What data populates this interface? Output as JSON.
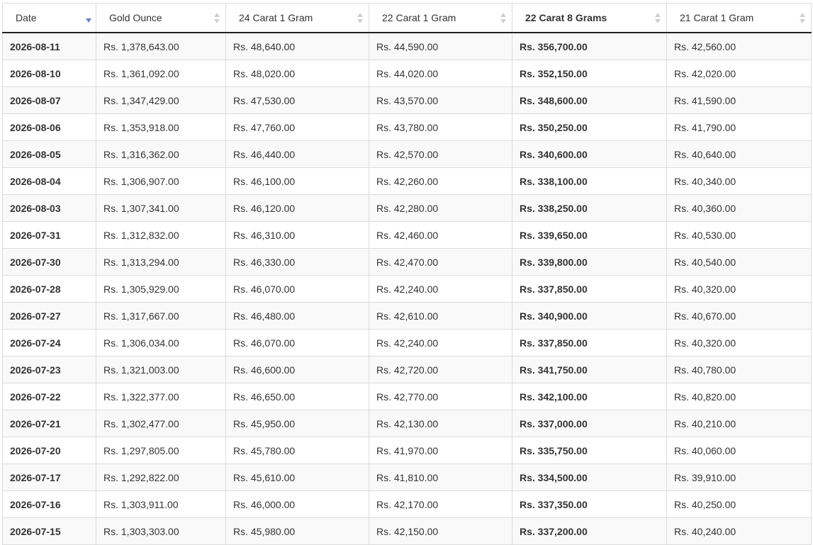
{
  "columns": [
    {
      "label": "Date",
      "sort": "descending"
    },
    {
      "label": "Gold Ounce",
      "sort": "none"
    },
    {
      "label": "24 Carat 1 Gram",
      "sort": "none"
    },
    {
      "label": "22 Carat 1 Gram",
      "sort": "none"
    },
    {
      "label": "22 Carat 8 Grams",
      "sort": "none"
    },
    {
      "label": "21 Carat 1 Gram",
      "sort": "none"
    }
  ],
  "rows": [
    [
      "2026-08-11",
      "Rs. 1,378,643.00",
      "Rs. 48,640.00",
      "Rs. 44,590.00",
      "Rs. 356,700.00",
      "Rs. 42,560.00"
    ],
    [
      "2026-08-10",
      "Rs. 1,361,092.00",
      "Rs. 48,020.00",
      "Rs. 44,020.00",
      "Rs. 352,150.00",
      "Rs. 42,020.00"
    ],
    [
      "2026-08-07",
      "Rs. 1,347,429.00",
      "Rs. 47,530.00",
      "Rs. 43,570.00",
      "Rs. 348,600.00",
      "Rs. 41,590.00"
    ],
    [
      "2026-08-06",
      "Rs. 1,353,918.00",
      "Rs. 47,760.00",
      "Rs. 43,780.00",
      "Rs. 350,250.00",
      "Rs. 41,790.00"
    ],
    [
      "2026-08-05",
      "Rs. 1,316,362.00",
      "Rs. 46,440.00",
      "Rs. 42,570.00",
      "Rs. 340,600.00",
      "Rs. 40,640.00"
    ],
    [
      "2026-08-04",
      "Rs. 1,306,907.00",
      "Rs. 46,100.00",
      "Rs. 42,260.00",
      "Rs. 338,100.00",
      "Rs. 40,340.00"
    ],
    [
      "2026-08-03",
      "Rs. 1,307,341.00",
      "Rs. 46,120.00",
      "Rs. 42,280.00",
      "Rs. 338,250.00",
      "Rs. 40,360.00"
    ],
    [
      "2026-07-31",
      "Rs. 1,312,832.00",
      "Rs. 46,310.00",
      "Rs. 42,460.00",
      "Rs. 339,650.00",
      "Rs. 40,530.00"
    ],
    [
      "2026-07-30",
      "Rs. 1,313,294.00",
      "Rs. 46,330.00",
      "Rs. 42,470.00",
      "Rs. 339,800.00",
      "Rs. 40,540.00"
    ],
    [
      "2026-07-28",
      "Rs. 1,305,929.00",
      "Rs. 46,070.00",
      "Rs. 42,240.00",
      "Rs. 337,850.00",
      "Rs. 40,320.00"
    ],
    [
      "2026-07-27",
      "Rs. 1,317,667.00",
      "Rs. 46,480.00",
      "Rs. 42,610.00",
      "Rs. 340,900.00",
      "Rs. 40,670.00"
    ],
    [
      "2026-07-24",
      "Rs. 1,306,034.00",
      "Rs. 46,070.00",
      "Rs. 42,240.00",
      "Rs. 337,850.00",
      "Rs. 40,320.00"
    ],
    [
      "2026-07-23",
      "Rs. 1,321,003.00",
      "Rs. 46,600.00",
      "Rs. 42,720.00",
      "Rs. 341,750.00",
      "Rs. 40,780.00"
    ],
    [
      "2026-07-22",
      "Rs. 1,322,377.00",
      "Rs. 46,650.00",
      "Rs. 42,770.00",
      "Rs. 342,100.00",
      "Rs. 40,820.00"
    ],
    [
      "2026-07-21",
      "Rs. 1,302,477.00",
      "Rs. 45,950.00",
      "Rs. 42,130.00",
      "Rs. 337,000.00",
      "Rs. 40,210.00"
    ],
    [
      "2026-07-20",
      "Rs. 1,297,805.00",
      "Rs. 45,780.00",
      "Rs. 41,970.00",
      "Rs. 335,750.00",
      "Rs. 40,060.00"
    ],
    [
      "2026-07-17",
      "Rs. 1,292,822.00",
      "Rs. 45,610.00",
      "Rs. 41,810.00",
      "Rs. 334,500.00",
      "Rs. 39,910.00"
    ],
    [
      "2026-07-16",
      "Rs. 1,303,911.00",
      "Rs. 46,000.00",
      "Rs. 42,170.00",
      "Rs. 337,350.00",
      "Rs. 40,250.00"
    ],
    [
      "2026-07-15",
      "Rs. 1,303,303.00",
      "Rs. 45,980.00",
      "Rs. 42,150.00",
      "Rs. 337,200.00",
      "Rs. 40,240.00"
    ]
  ],
  "colors": {
    "sort_active": "#6c7cc4",
    "sort_inactive": "#cfcfcf",
    "row_stripe": "#f9f9f9",
    "grid_line": "#dcdcdc",
    "header_rule": "#222222"
  }
}
